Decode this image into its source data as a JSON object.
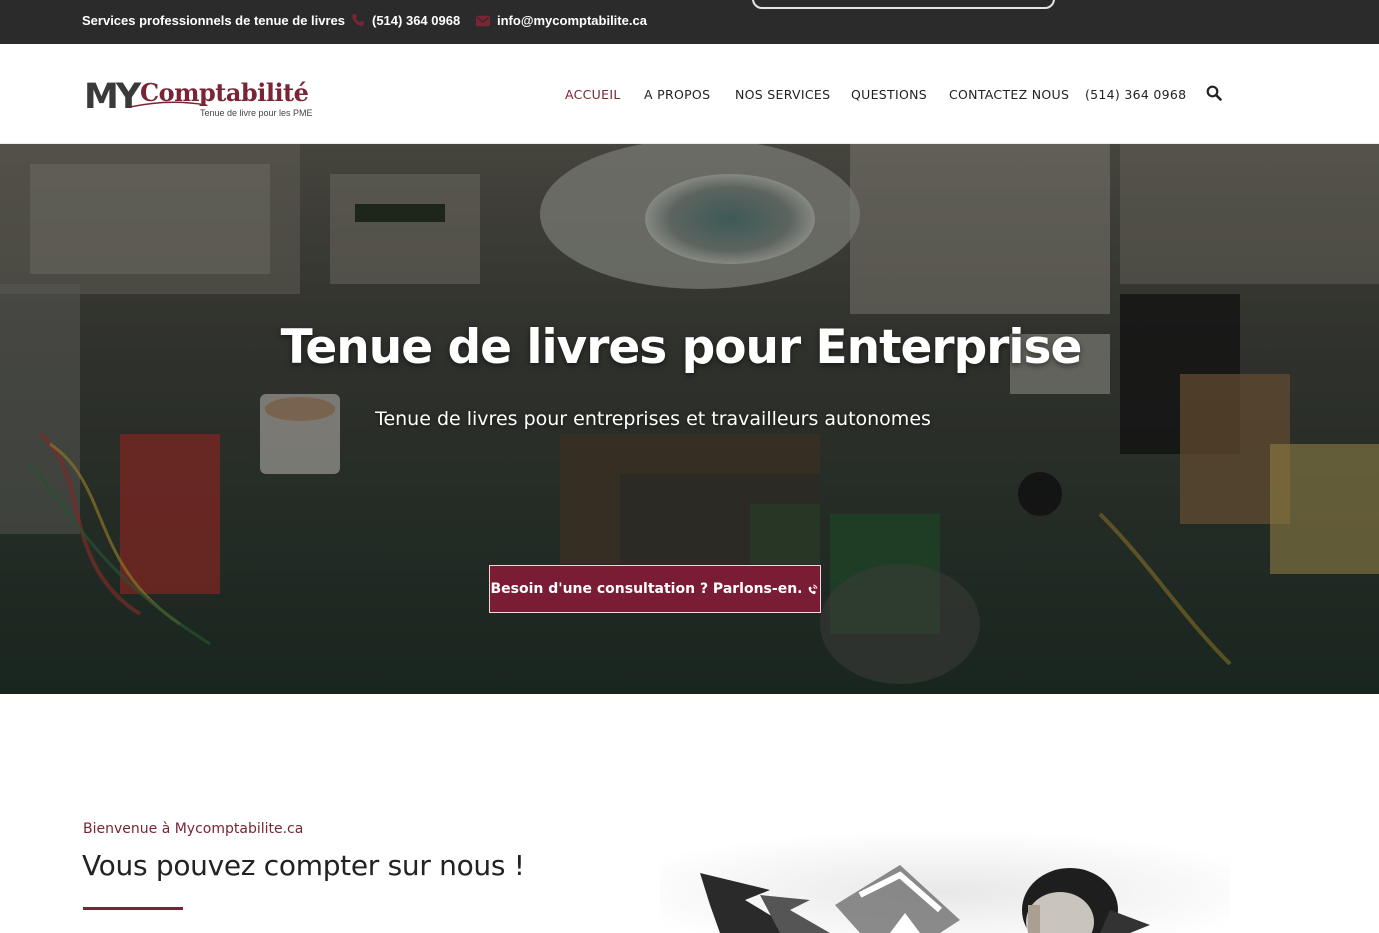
{
  "topbar": {
    "tagline": "Services professionnels de tenue de livres",
    "phone": "(514) 364 0968",
    "email": "info@mycomptabilite.ca",
    "phone_icon": "phone-icon",
    "email_icon": "envelope-icon"
  },
  "logo": {
    "my": "MY",
    "name": "Comptabilité",
    "tagline": "Tenue de livre pour les PME"
  },
  "nav": {
    "items": [
      {
        "label": "ACCUEIL",
        "active": true
      },
      {
        "label": "A PROPOS",
        "active": false
      },
      {
        "label": "NOS SERVICES",
        "active": false
      },
      {
        "label": "QUESTIONS",
        "active": false
      },
      {
        "label": "CONTACTEZ NOUS",
        "active": false
      },
      {
        "label": "(514) 364 0968",
        "active": false
      }
    ],
    "search_icon": "search-icon"
  },
  "hero": {
    "title": "Tenue de livres pour Enterprise",
    "subtitle": "Tenue de livres pour entreprises et travailleurs autonomes",
    "cta_label": "Besoin d'une consultation ? Parlons-en.",
    "cta_icon": "phone-volume-icon"
  },
  "welcome": {
    "kicker": "Bienvenue à Mycomptabilite.ca",
    "title": "Vous pouvez compter sur nous !"
  },
  "colors": {
    "brand": "#7a2535",
    "topbar": "#2b2b2b",
    "cta": "#7a1c33"
  }
}
